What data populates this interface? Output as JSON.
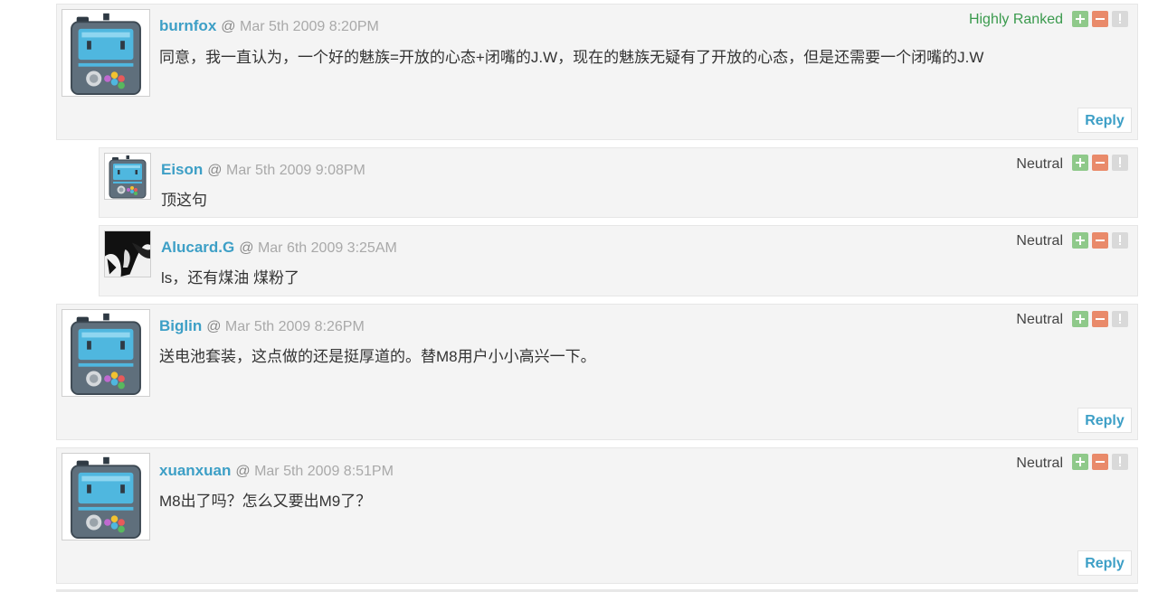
{
  "comments": [
    {
      "author": "burnfox",
      "at": "@",
      "timestamp": "Mar 5th 2009 8:20PM",
      "body": "同意，我一直认为，一个好的魅族=开放的心态+闭嘴的J.W，现在的魅族无疑有了开放的心态，但是还需要一个闭嘴的J.W",
      "rank": "Highly Ranked",
      "reply": "Reply"
    },
    {
      "author": "Eison",
      "at": "@",
      "timestamp": "Mar 5th 2009 9:08PM",
      "body": "顶这句",
      "rank": "Neutral"
    },
    {
      "author": "Alucard.G",
      "at": "@",
      "timestamp": "Mar 6th 2009 3:25AM",
      "body": "ls，还有煤油 煤粉了",
      "rank": "Neutral"
    },
    {
      "author": "Biglin",
      "at": "@",
      "timestamp": "Mar 5th 2009 8:26PM",
      "body": "送电池套装，这点做的还是挺厚道的。替M8用户小小高兴一下。",
      "rank": "Neutral",
      "reply": "Reply"
    },
    {
      "author": "xuanxuan",
      "at": "@",
      "timestamp": "Mar 5th 2009 8:51PM",
      "body": "M8出了吗？怎么又要出M9了？",
      "rank": "Neutral",
      "reply": "Reply"
    }
  ],
  "vote_icons": [
    "plus-icon",
    "minus-icon",
    "flag-icon"
  ],
  "colors": {
    "author": "#3d9fc6",
    "highly_ranked": "#3a9a4d",
    "vote_up": "#8fc98a",
    "vote_down": "#e98a6a",
    "flag": "#d9d9d9",
    "panel": "#f4f4f4"
  }
}
